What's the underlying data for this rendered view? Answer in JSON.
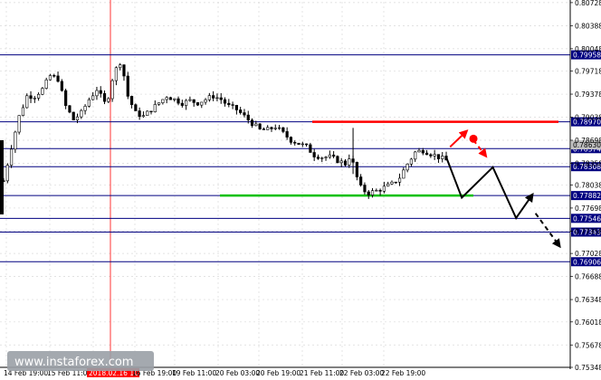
{
  "chart_data": {
    "type": "candlestick",
    "instrument_chart": "price chart",
    "watermark": "www.instaforex.com",
    "ylim": [
      0.75348,
      0.8074
    ],
    "y_ticks": [
      "0.80728",
      "0.80388",
      "0.80048",
      "0.79718",
      "0.79378",
      "0.79038",
      "0.78698",
      "0.78358",
      "0.78038",
      "0.77698",
      "0.77358",
      "0.77028",
      "0.76688",
      "0.76348",
      "0.76018",
      "0.75678",
      "0.75348"
    ],
    "x_ticks": [
      "14 Feb 19:00",
      "15 Feb 11:00",
      "2018.02.16 10:00",
      "16 Feb 19:00",
      "19 Feb 11:00",
      "20 Feb 03:00",
      "20 Feb 19:00",
      "21 Feb 11:00",
      "22 Feb 03:00",
      "22 Feb 19:00"
    ],
    "highlighted_x_label": "2018.02.16 10:00",
    "levels": [
      {
        "value": 0.79958,
        "label": "0.79958"
      },
      {
        "value": 0.7897,
        "label": "0.78970"
      },
      {
        "value": 0.78574,
        "label": "0.78574"
      },
      {
        "value": 0.78308,
        "label": "0.78308"
      },
      {
        "value": 0.77882,
        "label": "0.77882"
      },
      {
        "value": 0.77546,
        "label": "0.77546"
      },
      {
        "value": 0.77343,
        "label": "0.77343"
      },
      {
        "value": 0.76906,
        "label": "0.76906"
      }
    ],
    "current_price_label": "0.78630",
    "resistance_line": {
      "value": 0.7897,
      "color": "#ff0000"
    },
    "support_line": {
      "value": 0.77882,
      "color": "#00c000"
    },
    "price_path": [
      {
        "bar": 0,
        "price": 0.781
      },
      {
        "bar": 2,
        "price": 0.786
      },
      {
        "bar": 4,
        "price": 0.7905
      },
      {
        "bar": 6,
        "price": 0.7935
      },
      {
        "bar": 8,
        "price": 0.7935
      },
      {
        "bar": 10,
        "price": 0.7945
      },
      {
        "bar": 12,
        "price": 0.7965
      },
      {
        "bar": 14,
        "price": 0.796
      },
      {
        "bar": 16,
        "price": 0.792
      },
      {
        "bar": 18,
        "price": 0.79
      },
      {
        "bar": 20,
        "price": 0.791
      },
      {
        "bar": 22,
        "price": 0.793
      },
      {
        "bar": 24,
        "price": 0.7945
      },
      {
        "bar": 26,
        "price": 0.7925
      },
      {
        "bar": 27,
        "price": 0.7935
      },
      {
        "bar": 28,
        "price": 0.796
      },
      {
        "bar": 29,
        "price": 0.7975
      },
      {
        "bar": 30,
        "price": 0.7985
      },
      {
        "bar": 31,
        "price": 0.7965
      },
      {
        "bar": 32,
        "price": 0.7935
      },
      {
        "bar": 34,
        "price": 0.791
      },
      {
        "bar": 36,
        "price": 0.7905
      },
      {
        "bar": 38,
        "price": 0.7915
      },
      {
        "bar": 40,
        "price": 0.7925
      },
      {
        "bar": 42,
        "price": 0.7935
      },
      {
        "bar": 44,
        "price": 0.793
      },
      {
        "bar": 46,
        "price": 0.7925
      },
      {
        "bar": 48,
        "price": 0.7928
      },
      {
        "bar": 50,
        "price": 0.7925
      },
      {
        "bar": 52,
        "price": 0.793
      },
      {
        "bar": 54,
        "price": 0.7935
      },
      {
        "bar": 56,
        "price": 0.793
      },
      {
        "bar": 58,
        "price": 0.792
      },
      {
        "bar": 60,
        "price": 0.7915
      },
      {
        "bar": 62,
        "price": 0.7905
      },
      {
        "bar": 64,
        "price": 0.7895
      },
      {
        "bar": 66,
        "price": 0.7885
      },
      {
        "bar": 68,
        "price": 0.7885
      },
      {
        "bar": 70,
        "price": 0.789
      },
      {
        "bar": 72,
        "price": 0.788
      },
      {
        "bar": 74,
        "price": 0.787
      },
      {
        "bar": 76,
        "price": 0.7865
      },
      {
        "bar": 78,
        "price": 0.786
      },
      {
        "bar": 80,
        "price": 0.7848
      },
      {
        "bar": 82,
        "price": 0.7845
      },
      {
        "bar": 84,
        "price": 0.7845
      },
      {
        "bar": 86,
        "price": 0.784
      },
      {
        "bar": 88,
        "price": 0.7835
      },
      {
        "bar": 89,
        "price": 0.7845
      },
      {
        "bar": 90,
        "price": 0.7835
      },
      {
        "bar": 91,
        "price": 0.7815
      },
      {
        "bar": 92,
        "price": 0.78
      },
      {
        "bar": 93,
        "price": 0.7795
      },
      {
        "bar": 94,
        "price": 0.7792
      },
      {
        "bar": 96,
        "price": 0.7795
      },
      {
        "bar": 98,
        "price": 0.78
      },
      {
        "bar": 100,
        "price": 0.7805
      },
      {
        "bar": 102,
        "price": 0.7815
      },
      {
        "bar": 104,
        "price": 0.7835
      },
      {
        "bar": 106,
        "price": 0.7852
      },
      {
        "bar": 108,
        "price": 0.7855
      },
      {
        "bar": 110,
        "price": 0.785
      },
      {
        "bar": 112,
        "price": 0.7845
      },
      {
        "bar": 114,
        "price": 0.784
      }
    ],
    "forecast_paths": [
      {
        "color": "#000000",
        "dashed": false,
        "points": [
          [
            114,
            0.7845
          ],
          [
            118,
            0.7785
          ],
          [
            126,
            0.783
          ],
          [
            132,
            0.7755
          ],
          [
            136,
            0.7788
          ]
        ]
      },
      {
        "color": "#000000",
        "dashed": true,
        "points": [
          [
            137,
            0.7762
          ],
          [
            143,
            0.7715
          ]
        ]
      },
      {
        "color": "#ff0000",
        "dashed": false,
        "points": [
          [
            115,
            0.786
          ],
          [
            119,
            0.7882
          ]
        ]
      },
      {
        "color": "#ff0000",
        "dashed": true,
        "points": [
          [
            121,
            0.787
          ],
          [
            124,
            0.7848
          ]
        ]
      }
    ],
    "marker": {
      "bar": 121,
      "price": 0.7872,
      "color": "#ff0000"
    },
    "colors": {
      "grid": "#d9d9d9",
      "level": "#000080",
      "tag_bg": "#000080",
      "candle": "#000000",
      "vline": "#ff0000"
    }
  }
}
